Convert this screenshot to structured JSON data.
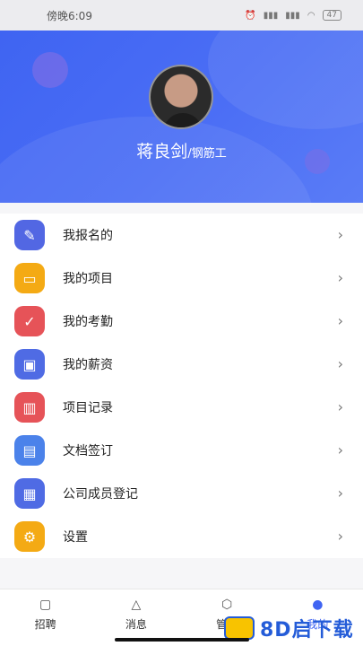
{
  "status_bar": {
    "time": "傍晚6:09",
    "battery": "47",
    "icons": [
      "alarm-icon",
      "signal-icon",
      "signal-icon",
      "wifi-icon",
      "battery-icon"
    ]
  },
  "profile": {
    "name": "蒋良剑",
    "role": "/钢筋工"
  },
  "menu": [
    {
      "label": "我报名的",
      "icon": "pencil-icon",
      "color": "#5267e3"
    },
    {
      "label": "我的项目",
      "icon": "folder-icon",
      "color": "#f4aa14"
    },
    {
      "label": "我的考勤",
      "icon": "calendar-check-icon",
      "color": "#e65358"
    },
    {
      "label": "我的薪资",
      "icon": "wallet-icon",
      "color": "#4f6be4"
    },
    {
      "label": "项目记录",
      "icon": "bar-chart-icon",
      "color": "#e65358"
    },
    {
      "label": "文档签订",
      "icon": "document-icon",
      "color": "#4b82ea"
    },
    {
      "label": "公司成员登记",
      "icon": "id-card-icon",
      "color": "#4f6be4"
    },
    {
      "label": "设置",
      "icon": "gear-icon",
      "color": "#f4aa14"
    }
  ],
  "tabs": [
    {
      "label": "招聘",
      "icon": "briefcase-icon",
      "active": false
    },
    {
      "label": "消息",
      "icon": "bell-icon",
      "active": false
    },
    {
      "label": "管理",
      "icon": "hexagon-icon",
      "active": false
    },
    {
      "label": "我的",
      "icon": "user-icon",
      "active": true
    }
  ],
  "watermark": "8D启下载"
}
